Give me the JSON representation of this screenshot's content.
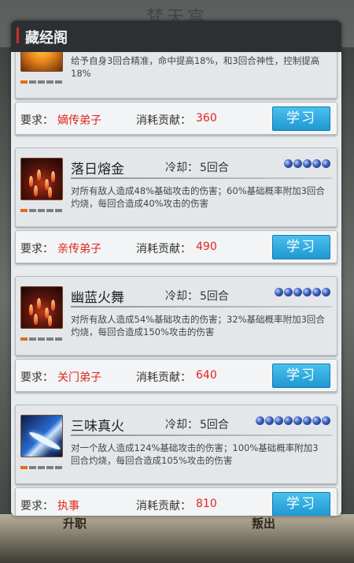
{
  "window": {
    "title": "藏经阁",
    "background_title": "梵天宫",
    "background_buttons": [
      "升职",
      "叛出"
    ]
  },
  "labels": {
    "requirement": "要求：",
    "cost": "消耗贡献：",
    "cooldown": "冷却：",
    "learn_button": "学习"
  },
  "skills": [
    {
      "name": "",
      "icon": "golden-demon-icon",
      "level_pips": 1,
      "cooldown": "",
      "orbs": 0,
      "description": "给予自身3回合精准，命中提高18%，和3回合神性，控制提高18%",
      "requirement": "嫡传弟子",
      "cost": "360"
    },
    {
      "name": "落日熔金",
      "icon": "fire-rain-icon",
      "level_pips": 1,
      "cooldown": "5回合",
      "orbs": 5,
      "description": "对所有敌人造成48%基础攻击的伤害；60%基础概率附加3回合灼烧，每回合造成40%攻击的伤害",
      "requirement": "亲传弟子",
      "cost": "490"
    },
    {
      "name": "幽蓝火舞",
      "icon": "fire-rain-icon",
      "level_pips": 1,
      "cooldown": "5回合",
      "orbs": 6,
      "description": "对所有敌人造成54%基础攻击的伤害；32%基础概率附加3回合灼烧，每回合造成150%攻击的伤害",
      "requirement": "关门弟子",
      "cost": "640"
    },
    {
      "name": "三味真火",
      "icon": "blue-flame-icon",
      "level_pips": 1,
      "cooldown": "5回合",
      "orbs": 8,
      "description": "对一个敌人造成124%基础攻击的伤害；100%基础概率附加3回合灼烧，每回合造成105%攻击的伤害",
      "requirement": "执事",
      "cost": "810"
    }
  ],
  "colors": {
    "requirement_text": "#e0251f",
    "cooldown_number": "#1d86c4",
    "learn_button": "#2aa6dd",
    "header_accent": "#d12a2a"
  }
}
